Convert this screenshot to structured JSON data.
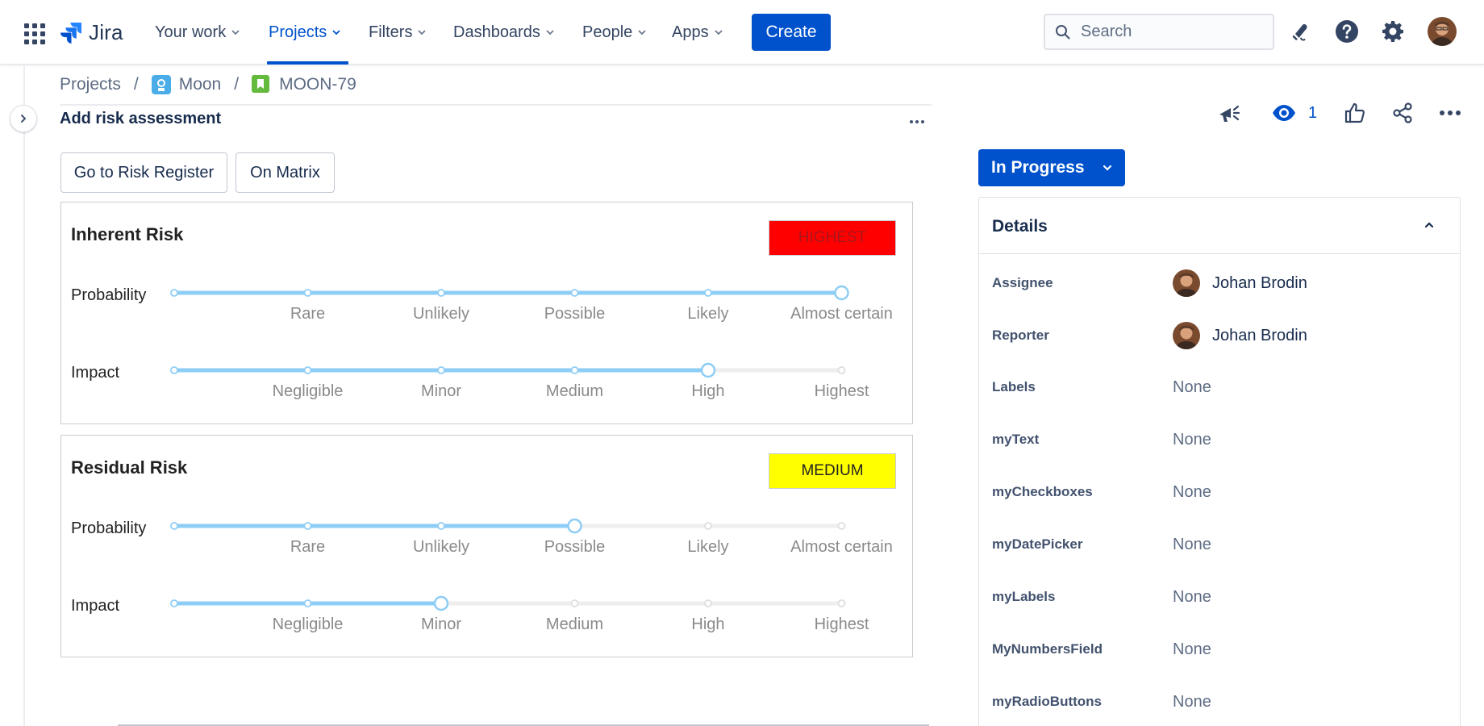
{
  "nav": {
    "logo_text": "Jira",
    "items": [
      {
        "label": "Your work",
        "active": false
      },
      {
        "label": "Projects",
        "active": true
      },
      {
        "label": "Filters",
        "active": false
      },
      {
        "label": "Dashboards",
        "active": false
      },
      {
        "label": "People",
        "active": false
      },
      {
        "label": "Apps",
        "active": false
      }
    ],
    "create_label": "Create",
    "search_placeholder": "Search",
    "icons": [
      "notifications-icon",
      "help-icon",
      "settings-icon",
      "profile-avatar"
    ]
  },
  "breadcrumb": {
    "items": [
      "Projects",
      "Moon",
      "MOON-79"
    ],
    "separator": "/"
  },
  "issue": {
    "title": "Add risk assessment",
    "buttons": [
      "Go to Risk Register",
      "On Matrix"
    ],
    "watchers": "1",
    "status": "In Progress"
  },
  "risk_panels": [
    {
      "title": "Inherent Risk",
      "level": "HIGHEST",
      "level_color": "#ff0000",
      "level_text_color": "#a8161b",
      "probability": {
        "label": "Probability",
        "ticks": [
          "",
          "Rare",
          "Unlikely",
          "Possible",
          "Likely",
          "Almost certain"
        ],
        "selected_index": 5
      },
      "impact": {
        "label": "Impact",
        "ticks": [
          "",
          "Negligible",
          "Minor",
          "Medium",
          "High",
          "Highest"
        ],
        "selected_index": 4
      }
    },
    {
      "title": "Residual Risk",
      "level": "MEDIUM",
      "level_color": "#ffff00",
      "level_text_color": "#222222",
      "probability": {
        "label": "Probability",
        "ticks": [
          "",
          "Rare",
          "Unlikely",
          "Possible",
          "Likely",
          "Almost certain"
        ],
        "selected_index": 3
      },
      "impact": {
        "label": "Impact",
        "ticks": [
          "",
          "Negligible",
          "Minor",
          "Medium",
          "High",
          "Highest"
        ],
        "selected_index": 2
      }
    }
  ],
  "details": {
    "title": "Details",
    "fields": [
      {
        "label": "Assignee",
        "value": "Johan Brodin",
        "type": "user"
      },
      {
        "label": "Reporter",
        "value": "Johan Brodin",
        "type": "user"
      },
      {
        "label": "Labels",
        "value": "None",
        "type": "text"
      },
      {
        "label": "myText",
        "value": "None",
        "type": "text"
      },
      {
        "label": "myCheckboxes",
        "value": "None",
        "type": "text"
      },
      {
        "label": "myDatePicker",
        "value": "None",
        "type": "text"
      },
      {
        "label": "myLabels",
        "value": "None",
        "type": "text"
      },
      {
        "label": "MyNumbersField",
        "value": "None",
        "type": "text"
      },
      {
        "label": "myRadioButtons",
        "value": "None",
        "type": "text"
      }
    ]
  },
  "colors": {
    "primary": "#0052cc",
    "slider_active": "#8ecdf5",
    "slider_inactive": "#eeeeee"
  }
}
